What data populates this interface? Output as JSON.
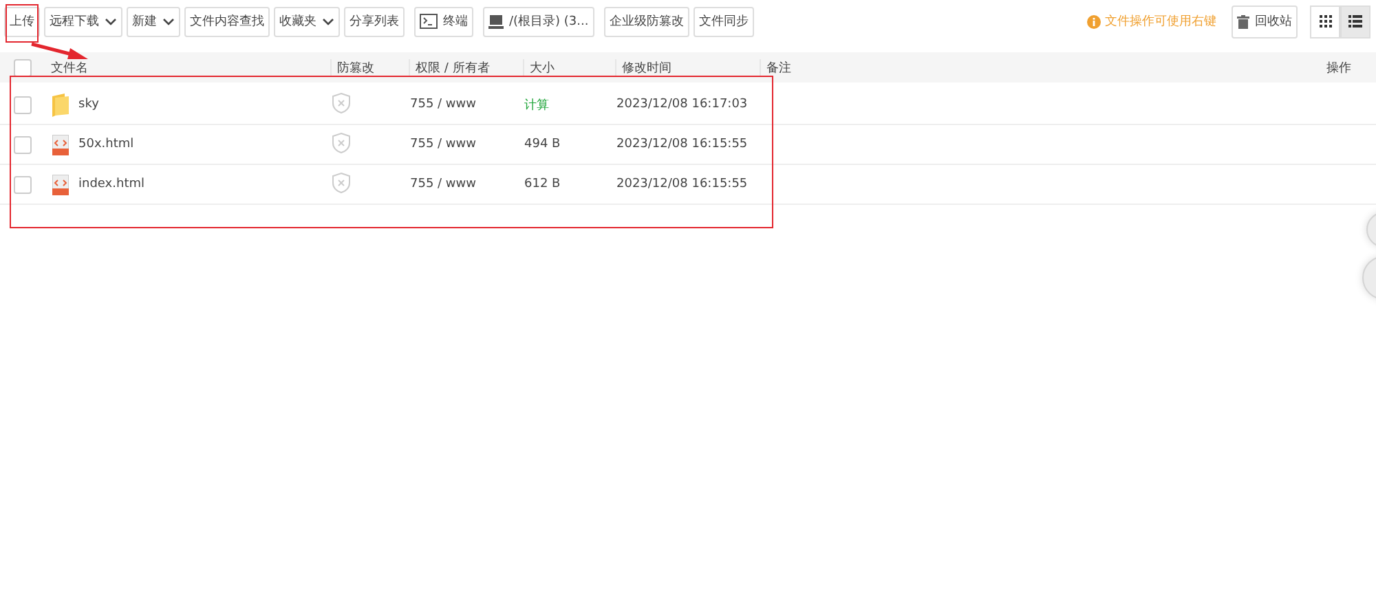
{
  "toolbar": {
    "buttons": [
      {
        "label": "上传",
        "kind": "plain"
      },
      {
        "label": "远程下载",
        "kind": "dropdown"
      },
      {
        "label": "新建",
        "kind": "dropdown"
      },
      {
        "label": "文件内容查找",
        "kind": "plain"
      },
      {
        "label": "收藏夹",
        "kind": "dropdown"
      },
      {
        "label": "分享列表",
        "kind": "plain"
      },
      {
        "label": "终端",
        "kind": "terminal"
      },
      {
        "label": "/(根目录) (3...",
        "kind": "path"
      },
      {
        "label": "企业级防篡改",
        "kind": "plain"
      },
      {
        "label": "文件同步",
        "kind": "plain"
      }
    ],
    "hint": "文件操作可使用右键",
    "recycle": "回收站",
    "views": [
      {
        "kind": "grid",
        "selected": false
      },
      {
        "kind": "list",
        "selected": true
      }
    ]
  },
  "table": {
    "select_all": {
      "checked": false
    },
    "columns": [
      "文件名",
      "防篡改",
      "权限 / 所有者",
      "大小",
      "修改时间",
      "备注",
      "操作"
    ],
    "rows": [
      {
        "name": "sky",
        "kind": "folder",
        "checked": false,
        "perm": "755 / www",
        "size": {
          "text": "计算",
          "kind": "action"
        },
        "mtime": "2023/12/08 16:17:03"
      },
      {
        "name": "50x.html",
        "kind": "html",
        "checked": false,
        "perm": "755 / www",
        "size": {
          "text": "494 B",
          "kind": "value"
        },
        "mtime": "2023/12/08 16:15:55"
      },
      {
        "name": "index.html",
        "kind": "html",
        "checked": false,
        "perm": "755 / www",
        "size": {
          "text": "612 B",
          "kind": "value"
        },
        "mtime": "2023/12/08 16:15:55"
      }
    ]
  }
}
